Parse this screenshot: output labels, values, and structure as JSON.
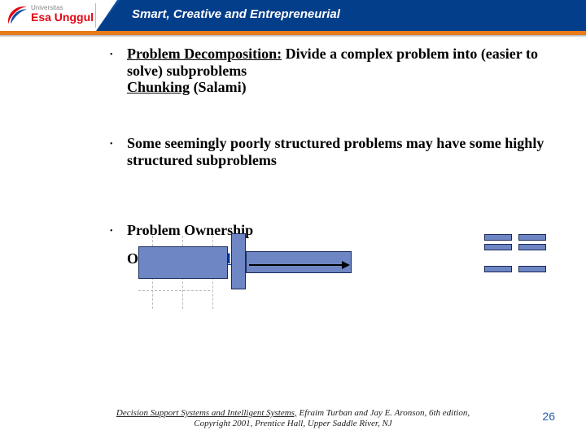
{
  "header": {
    "university_small": "Universitas",
    "university_name": "Esa Unggul",
    "slogan": "Smart, Creative and Entrepreneurial"
  },
  "bullets": [
    {
      "title": "Problem Decomposition:",
      "rest": " Divide a complex problem into (easier to solve) subproblems",
      "extra_underlined": "Chunking",
      "extra_rest": " (Salami)"
    },
    {
      "text": "Some seemingly poorly structured problems may have some highly structured subproblems"
    },
    {
      "text": "Problem Ownership"
    }
  ],
  "outcome": {
    "prefix": "O",
    "link_text": "blem Statement"
  },
  "footer": {
    "book": "Decision Support Systems and Intelligent Systems,",
    "rest1": " Efraim Turban and Jay E. Aronson, 6th edition,",
    "line2": "Copyright 2001, Prentice Hall, Upper Saddle River, NJ"
  },
  "page_number": "26"
}
